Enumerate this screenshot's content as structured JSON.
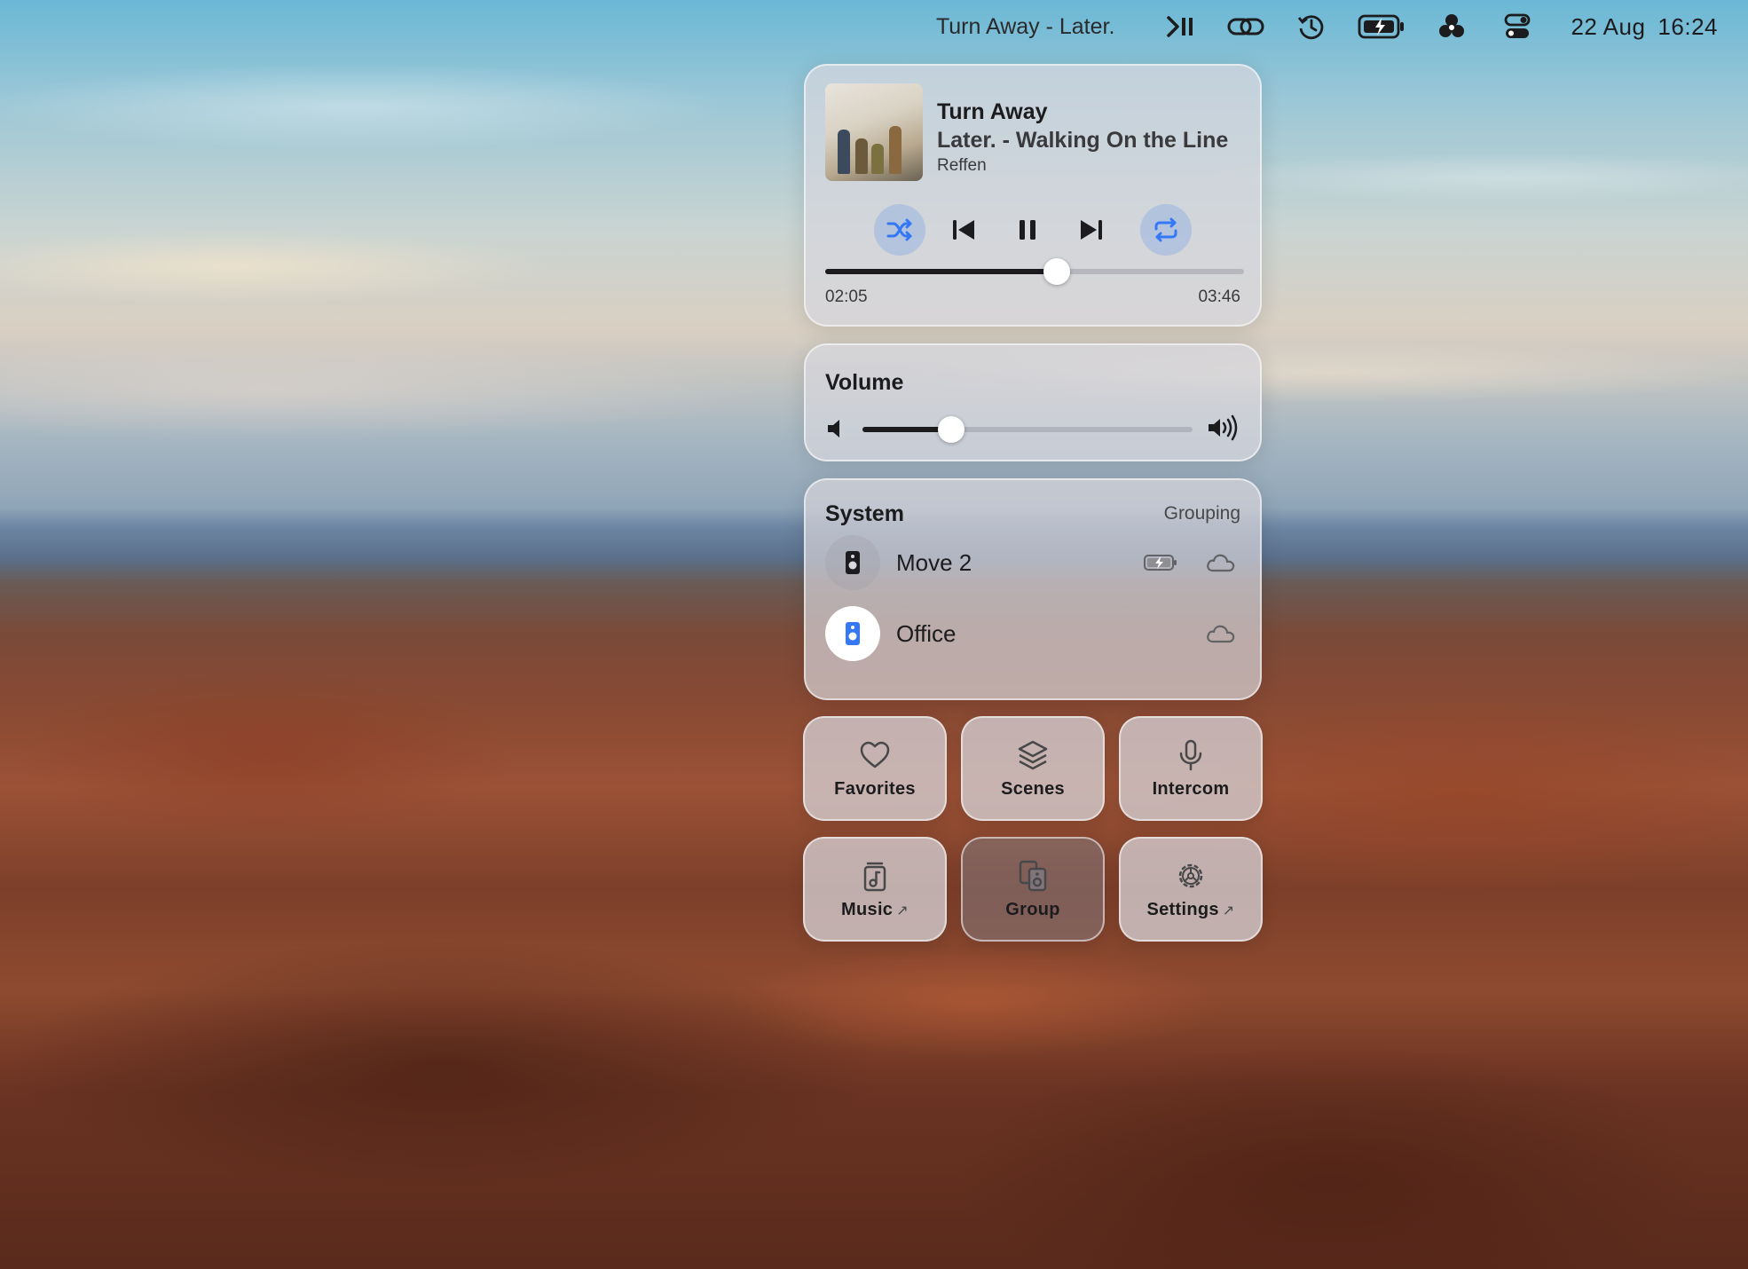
{
  "menubar": {
    "now_playing": "Turn Away - Later.",
    "date": "22 Aug",
    "time": "16:24",
    "icons": [
      "play-pause-icon",
      "link-icon",
      "time-machine-icon",
      "battery-icon",
      "creative-cloud-icon",
      "control-center-icon"
    ]
  },
  "now_playing": {
    "title": "Turn Away",
    "subtitle": "Later. - Walking On the Line",
    "artist": "Reffen",
    "elapsed": "02:05",
    "duration": "03:46",
    "progress": 0.553,
    "shuffle_on": true,
    "repeat_on": true
  },
  "volume": {
    "title": "Volume",
    "level": 0.27
  },
  "system": {
    "title": "System",
    "grouping_label": "Grouping",
    "speakers": [
      {
        "name": "Move 2",
        "active": false,
        "battery": true
      },
      {
        "name": "Office",
        "active": true,
        "battery": false
      }
    ]
  },
  "tiles": {
    "favorites": "Favorites",
    "scenes": "Scenes",
    "intercom": "Intercom",
    "music": "Music",
    "group": "Group",
    "settings": "Settings"
  },
  "colors": {
    "accent": "#3478f6",
    "text": "#1c1c1e"
  }
}
